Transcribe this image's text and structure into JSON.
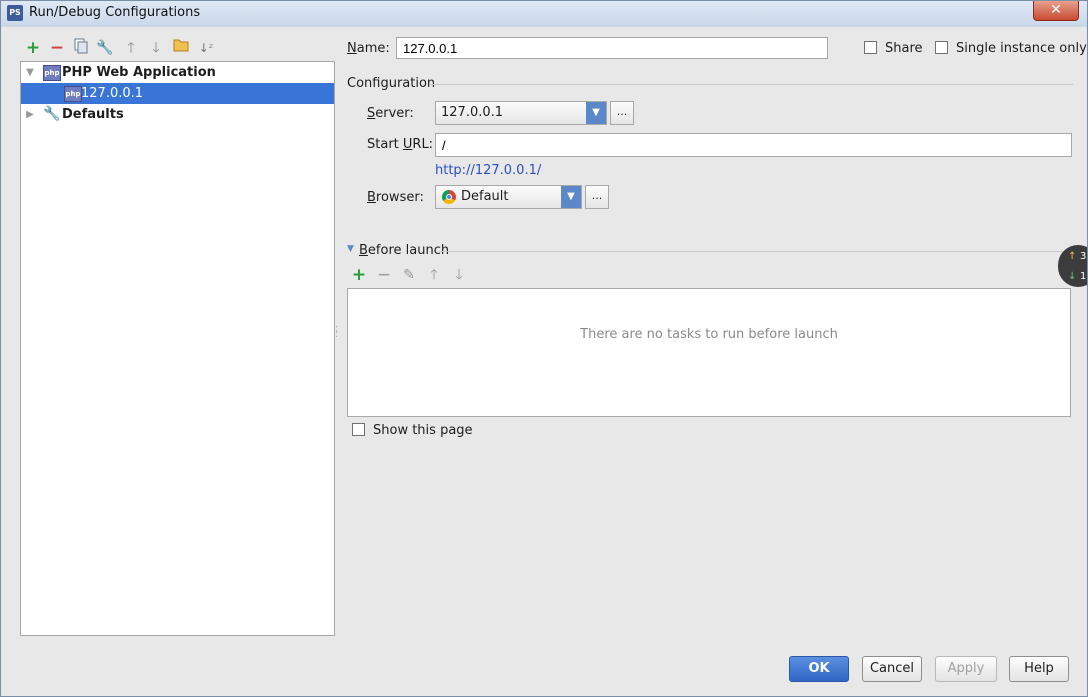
{
  "window": {
    "title": "Run/Debug Configurations",
    "close_label": "✕"
  },
  "toolbar": {
    "items": [
      "add",
      "remove",
      "copy",
      "edit-defaults",
      "move-up",
      "move-down",
      "folder",
      "sort"
    ]
  },
  "tree": {
    "items": [
      {
        "label": "PHP Web Application",
        "level": 0,
        "expanded": true,
        "icon": "php-icon"
      },
      {
        "label": "127.0.0.1",
        "level": 1,
        "selected": true,
        "icon": "php-icon"
      },
      {
        "label": "Defaults",
        "level": 0,
        "expanded": false,
        "icon": "wrench-icon"
      }
    ]
  },
  "form": {
    "name_label": "Name:",
    "name_value": "127.0.0.1",
    "share_label": "Share",
    "single_instance_label": "Single instance only",
    "configuration_label": "Configuration",
    "server_label": "Server:",
    "server_value": "127.0.0.1",
    "start_url_label": "Start URL:",
    "start_url_value": "/",
    "url_preview": "http://127.0.0.1/",
    "browser_label": "Browser:",
    "browser_value": "Default",
    "more_label": "..."
  },
  "before_launch": {
    "title": "Before launch",
    "empty_text": "There are no tasks to run before launch",
    "show_page_label": "Show this page"
  },
  "buttons": {
    "ok": "OK",
    "cancel": "Cancel",
    "apply": "Apply",
    "help": "Help"
  },
  "side_widget": {
    "up": "3.",
    "down": "1."
  },
  "colors": {
    "selection": "#3875d7",
    "ok_button": "#2f67c4",
    "add_green": "#2a9d3a",
    "remove_red": "#d04040"
  }
}
